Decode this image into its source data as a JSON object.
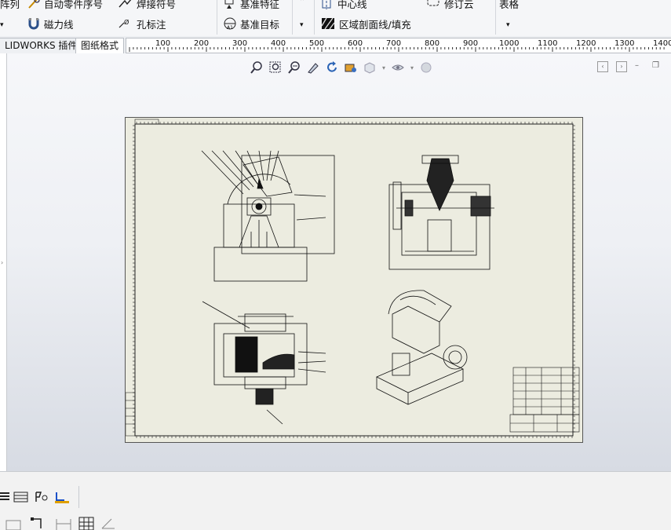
{
  "ribbon": {
    "cut_label": "阵列",
    "auto_balloon": "自动零件序号",
    "magnetic_line": "磁力线",
    "weld_symbol": "焊接符号",
    "hole_callout": "孔标注",
    "datum_feature": "基准特征",
    "datum_target": "基准目标",
    "centerline": "中心线",
    "area_hatch": "区域剖面线/填充",
    "revision_cloud": "修订云",
    "tables": "表格"
  },
  "tabs": [
    {
      "label": "LIDWORKS 插件"
    },
    {
      "label": "图纸格式"
    }
  ],
  "ruler": {
    "labels": [
      "100",
      "200",
      "300",
      "400",
      "500",
      "600",
      "700",
      "800",
      "900",
      "1000",
      "1100",
      "1200",
      "1300",
      "1400"
    ]
  },
  "colors": {
    "sheet_bg": "#ecece0",
    "viewport_top": "#f6f7fa",
    "viewport_bottom": "#d7dbe3",
    "ribbon_bg": "#f5f6f8"
  },
  "icons": [
    "zoom-to-fit-icon",
    "zoom-area-icon",
    "zoom-in-out-icon",
    "sketch-pencil-icon",
    "rotate-icon",
    "view-orientation-icon",
    "display-style-icon",
    "hide-show-icon",
    "appearance-icon"
  ]
}
